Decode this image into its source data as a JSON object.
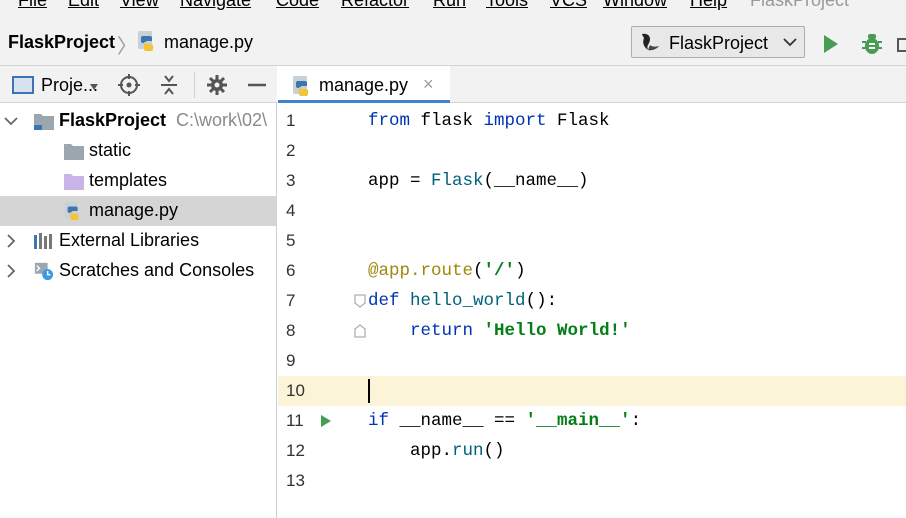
{
  "menu": {
    "items": [
      "File",
      "Edit",
      "View",
      "Navigate",
      "Code",
      "Refactor",
      "Run",
      "Tools",
      "VCS",
      "Window",
      "Help"
    ],
    "window_title": "FlaskProject"
  },
  "navbar": {
    "project": "FlaskProject",
    "file": "manage.py",
    "run_config": "FlaskProject"
  },
  "project_panel": {
    "view_label": "Proje...",
    "tree": [
      {
        "label": "FlaskProject",
        "path": "C:\\work\\02\\",
        "type": "project-folder",
        "expanded": true,
        "selected": false
      },
      {
        "label": "static",
        "type": "folder",
        "selected": false
      },
      {
        "label": "templates",
        "type": "templates-folder",
        "selected": false
      },
      {
        "label": "manage.py",
        "type": "python-file",
        "selected": true
      },
      {
        "label": "External Libraries",
        "type": "libraries",
        "expanded": false,
        "selected": false
      },
      {
        "label": "Scratches and Consoles",
        "type": "scratches",
        "expanded": false,
        "selected": false
      }
    ]
  },
  "editor": {
    "tab_label": "manage.py",
    "tab_close": "×",
    "current_line": 10,
    "lines": [
      {
        "n": "1",
        "tokens": [
          [
            "kw",
            "from"
          ],
          [
            "",
            " flask "
          ],
          [
            "kw",
            "import"
          ],
          [
            "",
            " Flask"
          ]
        ]
      },
      {
        "n": "2",
        "tokens": []
      },
      {
        "n": "3",
        "tokens": [
          [
            "",
            "app = "
          ],
          [
            "call",
            "Flask"
          ],
          [
            "",
            "(__name__)"
          ]
        ]
      },
      {
        "n": "4",
        "tokens": []
      },
      {
        "n": "5",
        "tokens": []
      },
      {
        "n": "6",
        "tokens": [
          [
            "deco",
            "@app.route"
          ],
          [
            "",
            "("
          ],
          [
            "str",
            "'/'"
          ],
          [
            "",
            ")"
          ]
        ]
      },
      {
        "n": "7",
        "tokens": [
          [
            "kw",
            "def"
          ],
          [
            "",
            " "
          ],
          [
            "fn",
            "hello_world"
          ],
          [
            "",
            "():"
          ]
        ]
      },
      {
        "n": "8",
        "tokens": [
          [
            "",
            "    "
          ],
          [
            "kw",
            "return"
          ],
          [
            "",
            " "
          ],
          [
            "str",
            "'Hello World!'"
          ]
        ]
      },
      {
        "n": "9",
        "tokens": []
      },
      {
        "n": "10",
        "tokens": []
      },
      {
        "n": "11",
        "tokens": [
          [
            "kw",
            "if"
          ],
          [
            "",
            " __name__ == "
          ],
          [
            "str",
            "'__main__'"
          ],
          [
            "",
            ":"
          ]
        ]
      },
      {
        "n": "12",
        "tokens": [
          [
            "",
            "    app."
          ],
          [
            "call",
            "run"
          ],
          [
            "",
            "()"
          ]
        ]
      },
      {
        "n": "13",
        "tokens": []
      }
    ]
  },
  "colors": {
    "keyword": "#0033b3",
    "string": "#067d17",
    "function": "#00627a",
    "decorator": "#9e880d",
    "current_line_bg": "#fcf4d8",
    "selection_bg": "#d5d5d5",
    "run_green": "#499c54"
  },
  "icons": [
    "flask-logo-icon",
    "python-file-icon",
    "run-icon",
    "debug-icon",
    "locate-icon",
    "collapse-all-icon",
    "settings-gear-icon",
    "minimize-icon",
    "folder-icon",
    "library-icon",
    "scratches-icon",
    "chevron-down-icon",
    "chevron-right-icon"
  ]
}
